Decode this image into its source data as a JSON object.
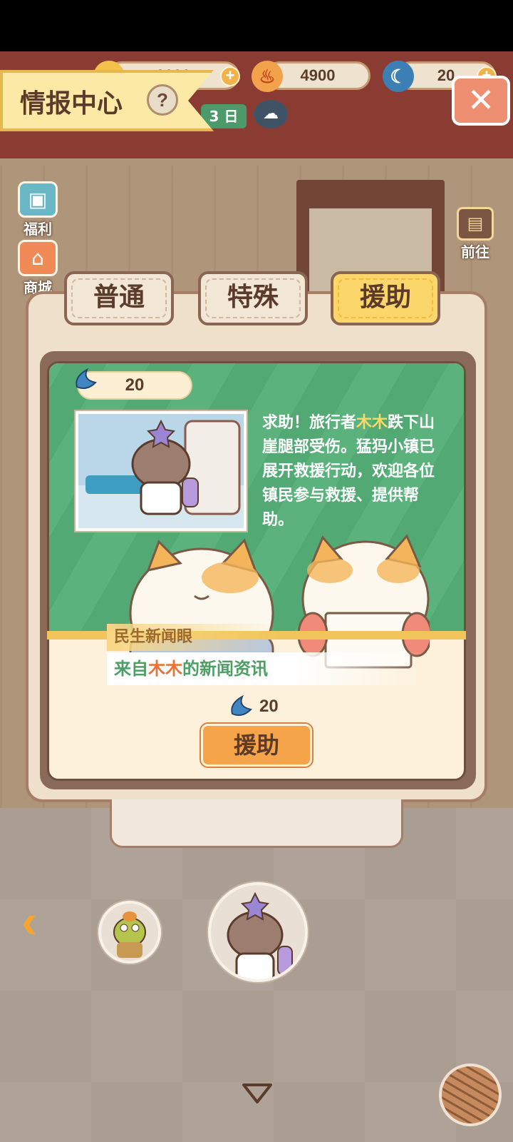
{
  "header": {
    "title": "情报中心",
    "help_label": "?",
    "close_label": "✕",
    "resources": [
      {
        "icon": "coin-icon",
        "value": "1000",
        "plus": "+"
      },
      {
        "icon": "fire-icon",
        "value": "4900",
        "plus": ""
      },
      {
        "icon": "blue-banana-icon",
        "value": "20",
        "plus": "+"
      }
    ],
    "day_badge": "3 日"
  },
  "sidebar": {
    "items": [
      {
        "label": "福利",
        "icon": "tv-icon"
      },
      {
        "label": "商城",
        "icon": "shop-icon"
      }
    ],
    "goto_label": "前往"
  },
  "tabs": [
    {
      "label": "普通",
      "active": false
    },
    {
      "label": "特殊",
      "active": false
    },
    {
      "label": "援助",
      "active": true
    }
  ],
  "news": {
    "reward": "20",
    "story_prefix": "求助！旅行者",
    "story_name": "木木",
    "story_suffix": "跌下山崖腿部受伤。猛犸小镇已展开救援行动，欢迎各位镇民参与救援、提供帮助。",
    "tag": "民生新闻眼",
    "headline_prefix": "来自",
    "headline_name": "木木",
    "headline_suffix": "的新闻资讯",
    "cost": "20",
    "action_label": "援助"
  },
  "bottom": {
    "back_label": "‹"
  },
  "colors": {
    "accent": "#fbd66a",
    "card_green": "#52a974",
    "button_orange": "#f5a44a"
  }
}
